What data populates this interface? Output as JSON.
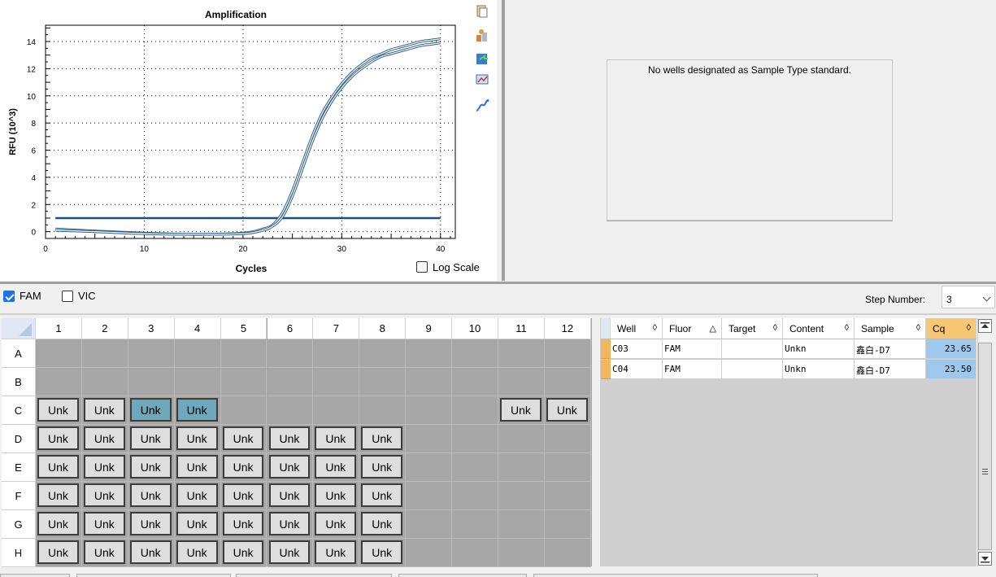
{
  "chart": {
    "title": "Amplification",
    "xlabel": "Cycles",
    "ylabel": "RFU (10^3)",
    "log_scale_label": "Log Scale",
    "log_scale_checked": false,
    "tools": [
      "copy-icon",
      "export-icon",
      "save-chart-icon",
      "chart-options-icon",
      "trace-styles-icon"
    ]
  },
  "chart_data": {
    "type": "line",
    "title": "Amplification",
    "xlabel": "Cycles",
    "ylabel": "RFU (10^3)",
    "xlim": [
      0,
      41.5
    ],
    "ylim": [
      -0.5,
      15.2
    ],
    "xticks": [
      0,
      10,
      20,
      30,
      40
    ],
    "yticks": [
      0,
      2,
      4,
      6,
      8,
      10,
      12,
      14
    ],
    "grid": true,
    "threshold": 1.0,
    "series": [
      {
        "x": [
          1,
          5,
          10,
          15,
          20,
          22,
          23,
          24,
          25,
          26,
          27,
          28,
          29,
          30,
          31,
          32,
          33,
          34,
          35,
          36,
          37,
          38,
          39,
          40
        ],
        "y": [
          0.2,
          0.05,
          -0.1,
          -0.2,
          -0.1,
          0.2,
          0.5,
          1.4,
          3.0,
          5.0,
          7.0,
          8.7,
          9.9,
          10.9,
          11.7,
          12.3,
          12.8,
          13.1,
          13.4,
          13.6,
          13.8,
          14.0,
          14.1,
          14.2
        ]
      },
      {
        "x": [
          1,
          5,
          10,
          15,
          20,
          22,
          23,
          24,
          25,
          26,
          27,
          28,
          29,
          30,
          31,
          32,
          33,
          34,
          35,
          36,
          37,
          38,
          39,
          40
        ],
        "y": [
          0.1,
          0.0,
          -0.15,
          -0.2,
          -0.15,
          0.1,
          0.4,
          1.1,
          2.6,
          4.6,
          6.6,
          8.3,
          9.6,
          10.6,
          11.4,
          12.0,
          12.5,
          12.9,
          13.1,
          13.3,
          13.5,
          13.7,
          13.8,
          13.9
        ]
      }
    ]
  },
  "standard_curve": {
    "message": "No wells designated as Sample Type standard."
  },
  "fluors": [
    {
      "label": "FAM",
      "checked": true
    },
    {
      "label": "VIC",
      "checked": false
    }
  ],
  "step": {
    "label": "Step Number:",
    "value": "3"
  },
  "plate": {
    "columns": [
      "1",
      "2",
      "3",
      "4",
      "5",
      "6",
      "7",
      "8",
      "9",
      "10",
      "11",
      "12"
    ],
    "rows": [
      "A",
      "B",
      "C",
      "D",
      "E",
      "F",
      "G",
      "H"
    ],
    "cell_label": "Unk",
    "wells": {
      "A": [],
      "B": [],
      "C": [
        1,
        2,
        3,
        4,
        11,
        12
      ],
      "D": [
        1,
        2,
        3,
        4,
        5,
        6,
        7,
        8
      ],
      "E": [
        1,
        2,
        3,
        4,
        5,
        6,
        7,
        8
      ],
      "F": [
        1,
        2,
        3,
        4,
        5,
        6,
        7,
        8
      ],
      "G": [
        1,
        2,
        3,
        4,
        5,
        6,
        7,
        8
      ],
      "H": [
        1,
        2,
        3,
        4,
        5,
        6,
        7,
        8
      ]
    },
    "selected": [
      "C3",
      "C4"
    ]
  },
  "table": {
    "headers": [
      {
        "label": "Well",
        "sort": "◊"
      },
      {
        "label": "Fluor",
        "sort": "△"
      },
      {
        "label": "Target",
        "sort": "◊"
      },
      {
        "label": "Content",
        "sort": "◊"
      },
      {
        "label": "Sample",
        "sort": "◊"
      },
      {
        "label": "Cq",
        "sort": "◊"
      }
    ],
    "rows": [
      [
        "C03",
        "FAM",
        "",
        "Unkn",
        "鑫白-D7",
        "23.65"
      ],
      [
        "C04",
        "FAM",
        "",
        "Unkn",
        "鑫白-D7",
        "23.50"
      ]
    ]
  },
  "colors": {
    "curve": "#2f5f8a",
    "threshold": "#1f4e79",
    "selected_well": "#6fa7bb",
    "cq_cell": "#9ec9ec",
    "row_marker": "#f4b55f"
  }
}
